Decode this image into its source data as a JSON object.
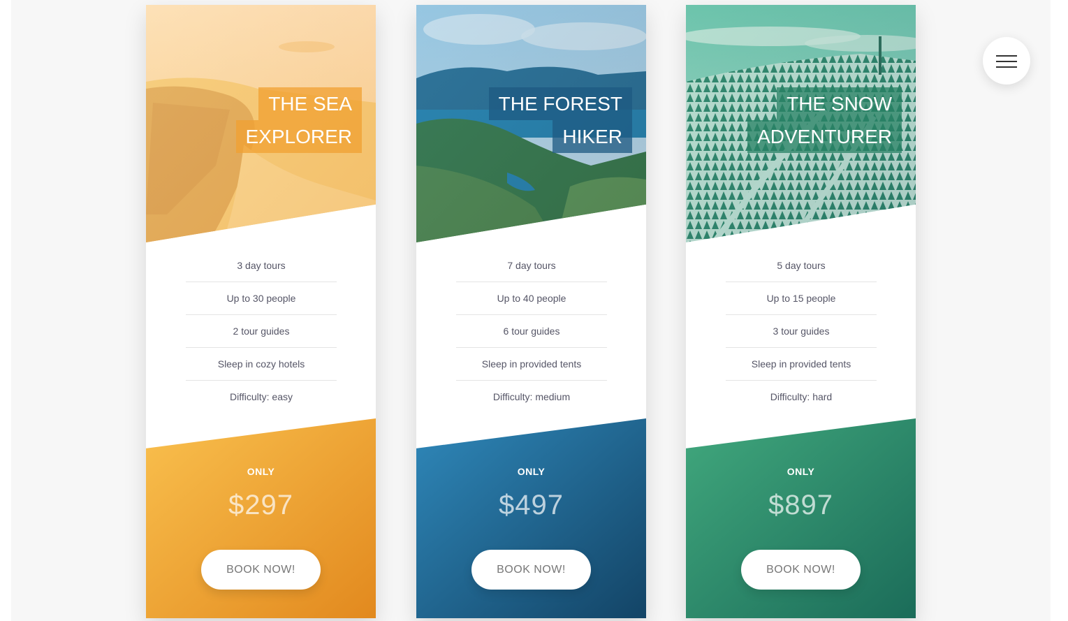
{
  "menu": {
    "icon": "hamburger-menu-icon"
  },
  "colors": {
    "sea": [
      "#f9c04e",
      "#e2891e"
    ],
    "forest": [
      "#2f88ba",
      "#134466"
    ],
    "snow": [
      "#41a87d",
      "#1b6c59"
    ],
    "feature_text": "#555566",
    "button_text": "#777777"
  },
  "cards": [
    {
      "title_line1": "THE SEA",
      "title_line2": "EXPLORER",
      "features": [
        "3 day tours",
        "Up to 30 people",
        "2 tour guides",
        "Sleep in cozy hotels",
        "Difficulty: easy"
      ],
      "price_label": "ONLY",
      "price": "$297",
      "button_label": "BOOK NOW!"
    },
    {
      "title_line1": "THE FOREST",
      "title_line2": "HIKER",
      "features": [
        "7 day tours",
        "Up to 40 people",
        "6 tour guides",
        "Sleep in provided tents",
        "Difficulty: medium"
      ],
      "price_label": "ONLY",
      "price": "$497",
      "button_label": "BOOK NOW!"
    },
    {
      "title_line1": "THE SNOW",
      "title_line2": "ADVENTURER",
      "features": [
        "5 day tours",
        "Up to 15 people",
        "3 tour guides",
        "Sleep in provided tents",
        "Difficulty: hard"
      ],
      "price_label": "ONLY",
      "price": "$897",
      "button_label": "BOOK NOW!"
    }
  ]
}
